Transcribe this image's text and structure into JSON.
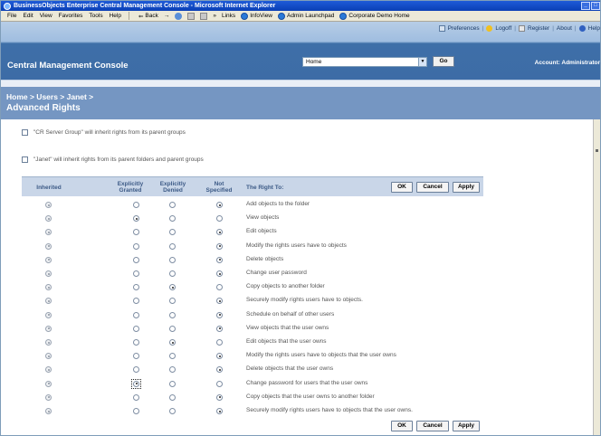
{
  "window": {
    "title": "BusinessObjects Enterprise Central Management Console - Microsoft Internet Explorer",
    "controls": [
      "_",
      "□",
      "x"
    ]
  },
  "menu": {
    "items": [
      "File",
      "Edit",
      "View",
      "Favorites",
      "Tools",
      "Help"
    ],
    "back_label": "Back",
    "links_label": "Links",
    "bookmarks": [
      "InfoView",
      "Admin Launchpad",
      "Corporate Demo Home"
    ]
  },
  "header": {
    "app_title": "Central Management Console",
    "links": [
      "Preferences",
      "Logoff",
      "Register",
      "About",
      "Help"
    ],
    "home_select_value": "Home",
    "go_label": "Go",
    "account_label": "Account: Administrator"
  },
  "breadcrumb": "Home > Users > Janet >",
  "page_title": "Advanced Rights",
  "inheritance": [
    {
      "text": "\"CR Server Group\" will inherit rights from its parent groups",
      "checked": false
    },
    {
      "text": "\"Janet\" will inherit rights from its parent folders and parent groups",
      "checked": false
    }
  ],
  "table": {
    "headers": {
      "inherited": "Inherited",
      "granted": "Explicitly Granted",
      "denied": "Explicitly Denied",
      "not_specified": "Not Specified",
      "right_to": "The Right To:"
    },
    "buttons": {
      "ok": "OK",
      "cancel": "Cancel",
      "apply": "Apply"
    },
    "rows": [
      {
        "label": "Add objects to the folder",
        "selected": "not_specified"
      },
      {
        "label": "View objects",
        "selected": "granted"
      },
      {
        "label": "Edit objects",
        "selected": "not_specified"
      },
      {
        "label": "Modify the rights users have to objects",
        "selected": "not_specified"
      },
      {
        "label": "Delete objects",
        "selected": "not_specified"
      },
      {
        "label": "Change user password",
        "selected": "not_specified"
      },
      {
        "label": "Copy objects to another folder",
        "selected": "denied"
      },
      {
        "label": "Securely modify rights users have to objects.",
        "selected": "not_specified"
      },
      {
        "label": "Schedule on behalf of other users",
        "selected": "not_specified"
      },
      {
        "label": "View objects that the user owns",
        "selected": "not_specified"
      },
      {
        "label": "Edit objects that the user owns",
        "selected": "denied"
      },
      {
        "label": "Modify the rights users have to objects that the user owns",
        "selected": "not_specified"
      },
      {
        "label": "Delete objects that the user owns",
        "selected": "not_specified"
      },
      {
        "label": "Change password for users that the user owns",
        "selected": "granted"
      },
      {
        "label": "Copy objects that the user owns to another folder",
        "selected": "not_specified"
      },
      {
        "label": "Securely modify rights users have to objects that the user owns.",
        "selected": "not_specified"
      }
    ]
  }
}
